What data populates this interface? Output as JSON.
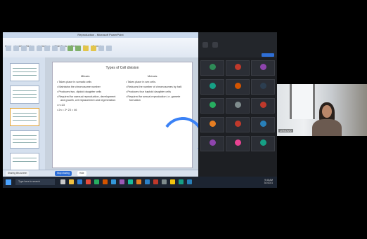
{
  "ppt": {
    "title": "Reproduction - Microsoft PowerPoint",
    "tabs": [
      "Home",
      "Insert",
      "Design",
      "Animations",
      "Slide Show",
      "Review",
      "View",
      "Format"
    ],
    "status_left": "Sharing this screen",
    "status_stop": "Stop sharing",
    "status_hide": "Hide"
  },
  "slide": {
    "title": "Types of Cell division",
    "mitosis_head": "Mitosis",
    "meiosis_head": "Meiosis",
    "mitosis": [
      "Takes place in somatic cells",
      "Maintains the chromosome number",
      "Produces two, diploid daughter cells",
      "Required for asexual reproduction, development and growth, cell replacement and regeneration",
      "n=23",
      "2n = 2* 23 = 46"
    ],
    "meiosis": [
      "Takes place in sex cells.",
      "Reduces the number of chromosomes by half.",
      "Produces four haploid daughter cells",
      "Required for sexual reproduction i.e. gamete formation"
    ]
  },
  "taskbar": {
    "search_placeholder": "Type here to search",
    "time": "9:46 AM",
    "date": "3/1/2021"
  },
  "meeting": {
    "participants": [
      {
        "name": "",
        "color": "#2e8b57"
      },
      {
        "name": "",
        "color": "#c0392b"
      },
      {
        "name": "",
        "color": "#8e44ad"
      },
      {
        "name": "",
        "color": "#16a085"
      },
      {
        "name": "",
        "color": "#d35400"
      },
      {
        "name": "",
        "color": "#2c3e50"
      },
      {
        "name": "",
        "color": "#27ae60"
      },
      {
        "name": "",
        "color": "#7f8c8d"
      },
      {
        "name": "",
        "color": "#c0392b"
      },
      {
        "name": "",
        "color": "#e67e22"
      },
      {
        "name": "",
        "color": "#c0392b"
      },
      {
        "name": "",
        "color": "#2980b9"
      },
      {
        "name": "",
        "color": "#8e44ad"
      },
      {
        "name": "",
        "color": "#e84393"
      },
      {
        "name": "",
        "color": "#16a085"
      }
    ]
  },
  "webcam": {
    "name": "LENOVO"
  },
  "colors": {
    "accent": "#3b82f6",
    "taskbar": "#1c2431",
    "meeting_bg": "#1d1f23"
  }
}
